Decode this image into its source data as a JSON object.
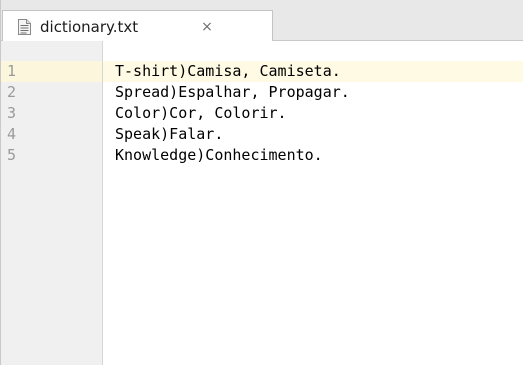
{
  "tab": {
    "label": "dictionary.txt",
    "close_glyph": "×",
    "icon": "text-file-icon"
  },
  "editor": {
    "current_line": 1,
    "lines": [
      {
        "number": "1",
        "text": "T-shirt)Camisa, Camiseta."
      },
      {
        "number": "2",
        "text": "Spread)Espalhar, Propagar."
      },
      {
        "number": "3",
        "text": "Color)Cor, Colorir."
      },
      {
        "number": "4",
        "text": "Speak)Falar."
      },
      {
        "number": "5",
        "text": "Knowledge)Conhecimento."
      }
    ]
  },
  "colors": {
    "gutter_bg": "#f0f0f0",
    "current_line_bg": "#fffae3",
    "tab_bar_bg": "#e8e8e8",
    "line_number": "#9a9a9a"
  }
}
